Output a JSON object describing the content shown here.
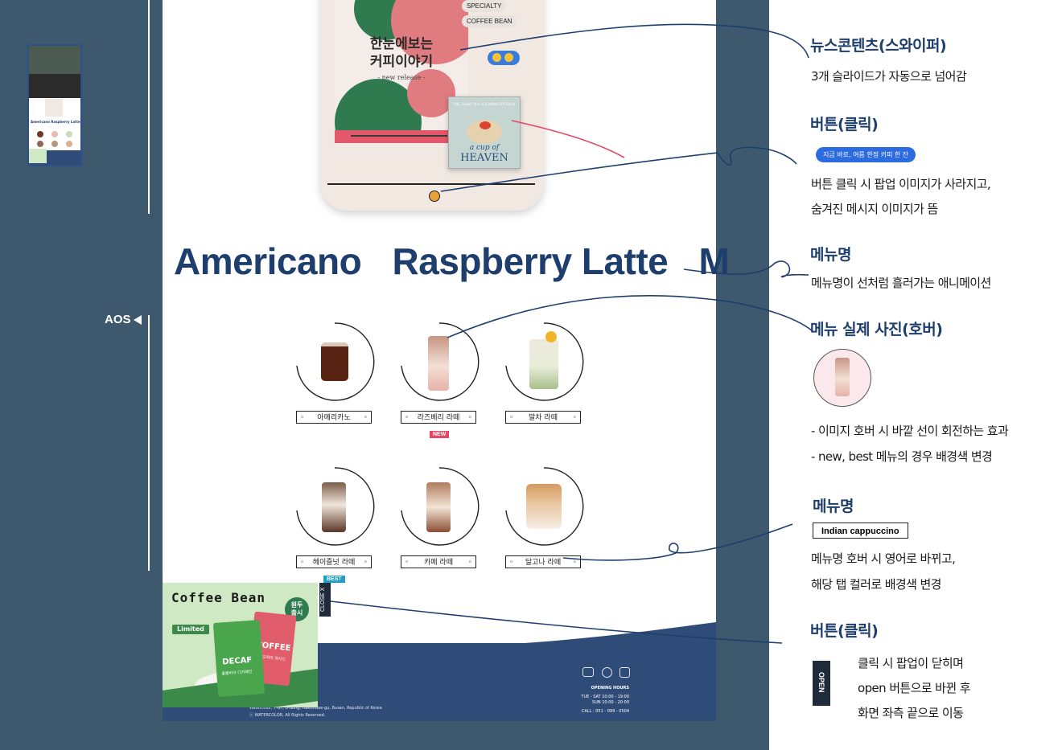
{
  "left_panel": {
    "aos_label": "AOS"
  },
  "slide": {
    "tags": [
      "SPECIALTY",
      "COFFEE BEAN"
    ],
    "title_line1": "한눈에보는",
    "title_line2": "커피이야기",
    "subtitle": "- new release -",
    "heaven_top": "Oh, look! It's a Coffee O'Clock",
    "heaven_line1": "a cup of",
    "heaven_line2": "HEAVEN"
  },
  "marquee": {
    "items": [
      "Americano",
      "Raspberry Latte",
      "M"
    ]
  },
  "menu": {
    "items": [
      {
        "label": "아메리카노"
      },
      {
        "label": "라즈베리 라떼",
        "badge": "NEW"
      },
      {
        "label": "말차 라떼"
      },
      {
        "label": "헤이즐넛 라떼"
      },
      {
        "label": "카페 라떼"
      },
      {
        "label": "달고나 라떼"
      }
    ],
    "best_badge": "BEST"
  },
  "popup": {
    "title": "Coffee Bean",
    "limited": "Limited",
    "new_launch_line1": "원두",
    "new_launch_line2": "출시",
    "bag1": "DECAF",
    "bag1_sub": "콜롬비아 디카페인",
    "bag2": "COFFEE",
    "bag2_sub": "에티오피아 워시드",
    "close": "CLOSE X"
  },
  "footer": {
    "address": "Watercolor, 7-8F, U-dong, Haeundae-gu, Busan, Republic of Korea",
    "copyright": "ⓒ WATERCOLOR, All Rights Reserved.",
    "hours_title": "OPENING HOURS",
    "hours_weekday": "TUE - SAT 10:00 - 19:00",
    "hours_sun": "SUN 10:00 - 20:00",
    "call": "CALL : 051 - 099 - 0504"
  },
  "annotations": {
    "news_title": "뉴스콘텐츠(스와이퍼)",
    "news_desc": "3개 슬라이드가 자동으로 넘어감",
    "button_title": "버튼(클릭)",
    "button_pill": "지금 바로, 여름 한정 커피 한 잔",
    "button_desc1": "버튼 클릭 시 팝업 이미지가 사라지고,",
    "button_desc2": "숨겨진 메시지 이미지가 뜸",
    "menu_name_title": "메뉴명",
    "menu_name_desc": "메뉴명이 선처럼 흘러가는 애니메이션",
    "photo_title": "메뉴 실제 사진(호버)",
    "photo_desc1": "-  이미지 호버 시 바깥 선이 회전하는 효과",
    "photo_desc2": "- new, best 메뉴의 경우 배경색 변경",
    "menu_hover_title": "메뉴명",
    "menu_hover_box": "Indian cappuccino",
    "menu_hover_desc1": "메뉴명 호버 시 영어로 바뀌고,",
    "menu_hover_desc2": "해당 탭 컬러로 배경색 변경",
    "close_title": "버튼(클릭)",
    "open_label": "OPEN",
    "close_desc1": "클릭 시 팝업이 닫히며",
    "close_desc2": "open 버튼으로 바뀐 후",
    "close_desc3": "화면 좌측 끝으로 이동"
  },
  "colors": {
    "navy": "#1e3f6e",
    "panel": "#3e586d",
    "pink": "#e34762",
    "blue": "#2d6be0",
    "green": "#2f7a4f"
  }
}
